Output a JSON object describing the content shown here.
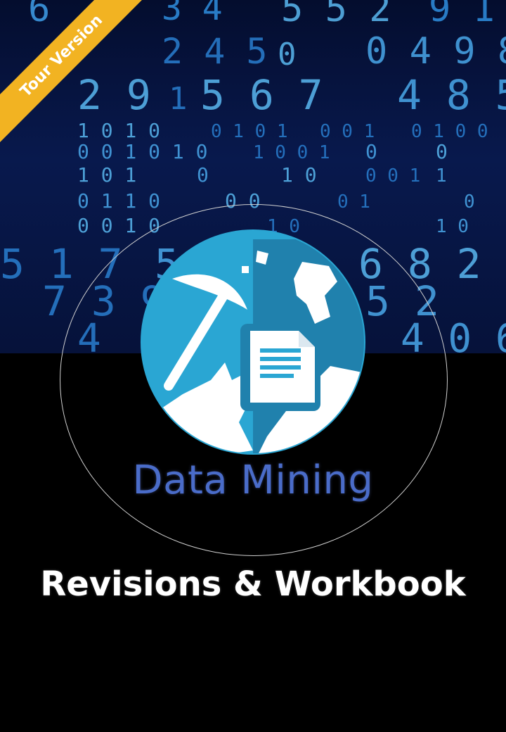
{
  "cover": {
    "ribbon_label": "Tour Version",
    "title": "Data Mining",
    "subtitle": "Revisions & Workbook"
  },
  "icons": {
    "logo": "data-mining-pickaxe-document-icon"
  },
  "colors": {
    "hero_background": "#08194d",
    "title_blue": "#4a6cc9",
    "logo_circle": "#2aa6d3",
    "logo_shadow": "#2081ad",
    "ribbon": "#f2b322"
  }
}
